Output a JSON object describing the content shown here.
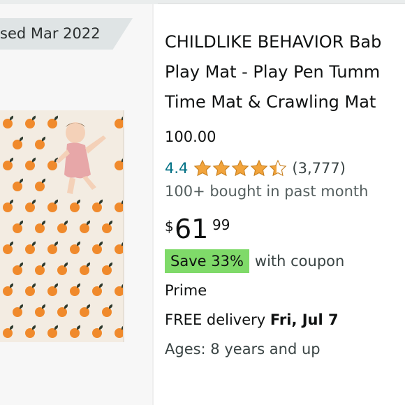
{
  "banner": {
    "date_text": "sed Mar 2022"
  },
  "product": {
    "title_lines": [
      "CHILDLIKE BEHAVIOR Bab",
      "Play Mat - Play Pen Tumm",
      "Time Mat & Crawling Mat"
    ],
    "model": "100.00",
    "rating": {
      "value": "4.4",
      "count": "(3,777)",
      "stars": 4.4
    },
    "bought": "100+ bought in past month",
    "price": {
      "currency": "$",
      "whole": "61",
      "fraction": "99"
    },
    "coupon": {
      "badge": "Save 33%",
      "text": "with coupon"
    },
    "prime": "Prime",
    "delivery": {
      "prefix": "FREE delivery",
      "date": "Fri, Jul 7"
    },
    "ages": "Ages: 8 years and up"
  },
  "colors": {
    "star": "#f2a43c",
    "rating_link": "#007185",
    "save_badge": "#7fda69",
    "orange": "#f08a2c"
  }
}
